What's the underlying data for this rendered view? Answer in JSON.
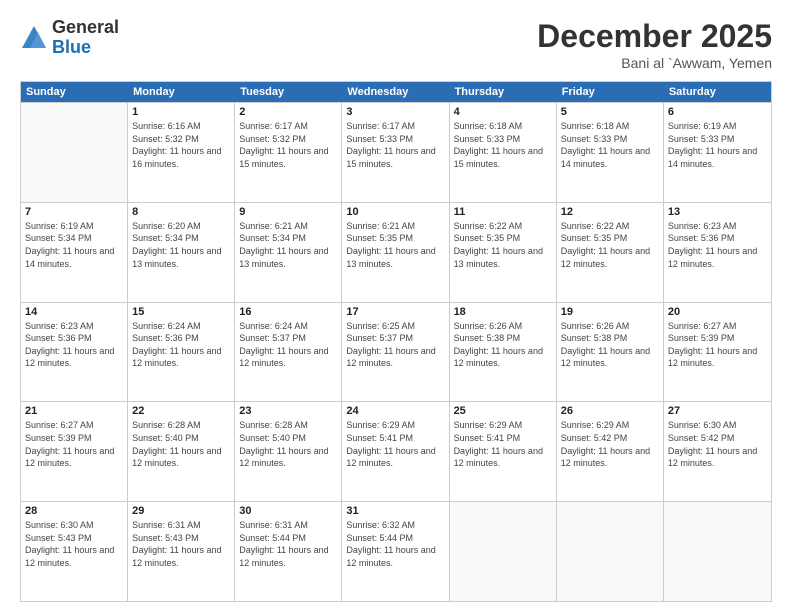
{
  "logo": {
    "general": "General",
    "blue": "Blue"
  },
  "title": {
    "month": "December 2025",
    "location": "Bani al `Awwam, Yemen"
  },
  "calendar": {
    "headers": [
      "Sunday",
      "Monday",
      "Tuesday",
      "Wednesday",
      "Thursday",
      "Friday",
      "Saturday"
    ],
    "rows": [
      [
        {
          "day": "",
          "empty": true
        },
        {
          "day": "1",
          "sunrise": "Sunrise: 6:16 AM",
          "sunset": "Sunset: 5:32 PM",
          "daylight": "Daylight: 11 hours and 16 minutes."
        },
        {
          "day": "2",
          "sunrise": "Sunrise: 6:17 AM",
          "sunset": "Sunset: 5:32 PM",
          "daylight": "Daylight: 11 hours and 15 minutes."
        },
        {
          "day": "3",
          "sunrise": "Sunrise: 6:17 AM",
          "sunset": "Sunset: 5:33 PM",
          "daylight": "Daylight: 11 hours and 15 minutes."
        },
        {
          "day": "4",
          "sunrise": "Sunrise: 6:18 AM",
          "sunset": "Sunset: 5:33 PM",
          "daylight": "Daylight: 11 hours and 15 minutes."
        },
        {
          "day": "5",
          "sunrise": "Sunrise: 6:18 AM",
          "sunset": "Sunset: 5:33 PM",
          "daylight": "Daylight: 11 hours and 14 minutes."
        },
        {
          "day": "6",
          "sunrise": "Sunrise: 6:19 AM",
          "sunset": "Sunset: 5:33 PM",
          "daylight": "Daylight: 11 hours and 14 minutes."
        }
      ],
      [
        {
          "day": "7",
          "sunrise": "Sunrise: 6:19 AM",
          "sunset": "Sunset: 5:34 PM",
          "daylight": "Daylight: 11 hours and 14 minutes."
        },
        {
          "day": "8",
          "sunrise": "Sunrise: 6:20 AM",
          "sunset": "Sunset: 5:34 PM",
          "daylight": "Daylight: 11 hours and 13 minutes."
        },
        {
          "day": "9",
          "sunrise": "Sunrise: 6:21 AM",
          "sunset": "Sunset: 5:34 PM",
          "daylight": "Daylight: 11 hours and 13 minutes."
        },
        {
          "day": "10",
          "sunrise": "Sunrise: 6:21 AM",
          "sunset": "Sunset: 5:35 PM",
          "daylight": "Daylight: 11 hours and 13 minutes."
        },
        {
          "day": "11",
          "sunrise": "Sunrise: 6:22 AM",
          "sunset": "Sunset: 5:35 PM",
          "daylight": "Daylight: 11 hours and 13 minutes."
        },
        {
          "day": "12",
          "sunrise": "Sunrise: 6:22 AM",
          "sunset": "Sunset: 5:35 PM",
          "daylight": "Daylight: 11 hours and 12 minutes."
        },
        {
          "day": "13",
          "sunrise": "Sunrise: 6:23 AM",
          "sunset": "Sunset: 5:36 PM",
          "daylight": "Daylight: 11 hours and 12 minutes."
        }
      ],
      [
        {
          "day": "14",
          "sunrise": "Sunrise: 6:23 AM",
          "sunset": "Sunset: 5:36 PM",
          "daylight": "Daylight: 11 hours and 12 minutes."
        },
        {
          "day": "15",
          "sunrise": "Sunrise: 6:24 AM",
          "sunset": "Sunset: 5:36 PM",
          "daylight": "Daylight: 11 hours and 12 minutes."
        },
        {
          "day": "16",
          "sunrise": "Sunrise: 6:24 AM",
          "sunset": "Sunset: 5:37 PM",
          "daylight": "Daylight: 11 hours and 12 minutes."
        },
        {
          "day": "17",
          "sunrise": "Sunrise: 6:25 AM",
          "sunset": "Sunset: 5:37 PM",
          "daylight": "Daylight: 11 hours and 12 minutes."
        },
        {
          "day": "18",
          "sunrise": "Sunrise: 6:26 AM",
          "sunset": "Sunset: 5:38 PM",
          "daylight": "Daylight: 11 hours and 12 minutes."
        },
        {
          "day": "19",
          "sunrise": "Sunrise: 6:26 AM",
          "sunset": "Sunset: 5:38 PM",
          "daylight": "Daylight: 11 hours and 12 minutes."
        },
        {
          "day": "20",
          "sunrise": "Sunrise: 6:27 AM",
          "sunset": "Sunset: 5:39 PM",
          "daylight": "Daylight: 11 hours and 12 minutes."
        }
      ],
      [
        {
          "day": "21",
          "sunrise": "Sunrise: 6:27 AM",
          "sunset": "Sunset: 5:39 PM",
          "daylight": "Daylight: 11 hours and 12 minutes."
        },
        {
          "day": "22",
          "sunrise": "Sunrise: 6:28 AM",
          "sunset": "Sunset: 5:40 PM",
          "daylight": "Daylight: 11 hours and 12 minutes."
        },
        {
          "day": "23",
          "sunrise": "Sunrise: 6:28 AM",
          "sunset": "Sunset: 5:40 PM",
          "daylight": "Daylight: 11 hours and 12 minutes."
        },
        {
          "day": "24",
          "sunrise": "Sunrise: 6:29 AM",
          "sunset": "Sunset: 5:41 PM",
          "daylight": "Daylight: 11 hours and 12 minutes."
        },
        {
          "day": "25",
          "sunrise": "Sunrise: 6:29 AM",
          "sunset": "Sunset: 5:41 PM",
          "daylight": "Daylight: 11 hours and 12 minutes."
        },
        {
          "day": "26",
          "sunrise": "Sunrise: 6:29 AM",
          "sunset": "Sunset: 5:42 PM",
          "daylight": "Daylight: 11 hours and 12 minutes."
        },
        {
          "day": "27",
          "sunrise": "Sunrise: 6:30 AM",
          "sunset": "Sunset: 5:42 PM",
          "daylight": "Daylight: 11 hours and 12 minutes."
        }
      ],
      [
        {
          "day": "28",
          "sunrise": "Sunrise: 6:30 AM",
          "sunset": "Sunset: 5:43 PM",
          "daylight": "Daylight: 11 hours and 12 minutes."
        },
        {
          "day": "29",
          "sunrise": "Sunrise: 6:31 AM",
          "sunset": "Sunset: 5:43 PM",
          "daylight": "Daylight: 11 hours and 12 minutes."
        },
        {
          "day": "30",
          "sunrise": "Sunrise: 6:31 AM",
          "sunset": "Sunset: 5:44 PM",
          "daylight": "Daylight: 11 hours and 12 minutes."
        },
        {
          "day": "31",
          "sunrise": "Sunrise: 6:32 AM",
          "sunset": "Sunset: 5:44 PM",
          "daylight": "Daylight: 11 hours and 12 minutes."
        },
        {
          "day": "",
          "empty": true
        },
        {
          "day": "",
          "empty": true
        },
        {
          "day": "",
          "empty": true
        }
      ]
    ]
  }
}
